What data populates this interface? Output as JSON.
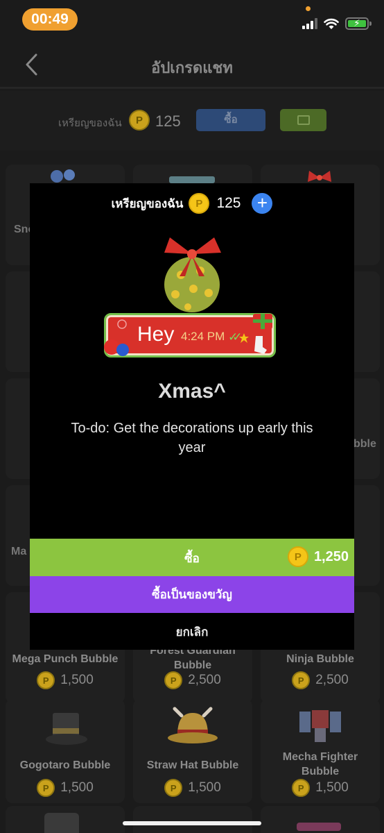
{
  "status_bar": {
    "time": "00:49"
  },
  "nav": {
    "title": "อัปเกรดแชท"
  },
  "top_coins": {
    "label": "เหรียญของฉัน",
    "value": "125",
    "buy_label": "ซื้อ"
  },
  "grid": {
    "partial_labels": [
      "Sno",
      "Ma",
      "bble"
    ],
    "items": [
      {
        "name": "Mega Punch Bubble",
        "price": "1,500"
      },
      {
        "name": "Forest Guardian Bubble",
        "price": "2,500"
      },
      {
        "name": "Ninja Bubble",
        "price": "2,500"
      },
      {
        "name": "Gogotaro Bubble",
        "price": "1,500"
      },
      {
        "name": "Straw Hat Bubble",
        "price": "1,500"
      },
      {
        "name": "Mecha Fighter Bubble",
        "price": "1,500"
      }
    ]
  },
  "modal": {
    "coins_label": "เหรียญของฉัน",
    "coins_value": "125",
    "preview": {
      "text": "Hey",
      "time": "4:24 PM"
    },
    "title": "Xmas^",
    "description": "To-do: Get the decorations up early this year",
    "buy_label": "ซื้อ",
    "buy_price": "1,250",
    "gift_label": "ซื้อเป็นของขวัญ",
    "cancel_label": "ยกเลิก"
  },
  "colors": {
    "accent_buy": "#8cc540",
    "accent_gift": "#8c44e8",
    "coin": "#f5c518",
    "plus": "#3b84f0"
  }
}
